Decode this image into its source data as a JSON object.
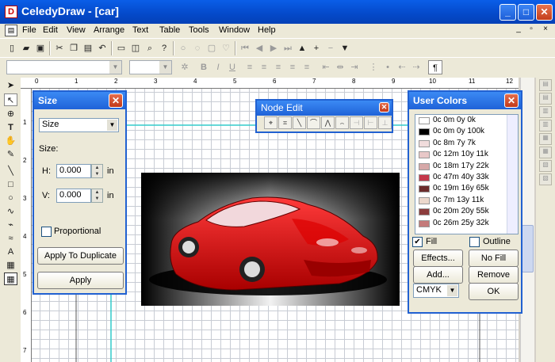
{
  "window": {
    "title": "CeledyDraw - [car]",
    "minimize": "_",
    "maximize": "□",
    "close": "✕"
  },
  "menu": {
    "items": [
      "File",
      "Edit",
      "View",
      "Arrange",
      "Text",
      "Table",
      "Tools",
      "Window",
      "Help"
    ],
    "mdi": [
      "_",
      "▫",
      "×"
    ]
  },
  "ruler": {
    "top_numbers": [
      "0",
      "1",
      "2",
      "3",
      "4",
      "5",
      "6",
      "7",
      "8",
      "9",
      "10",
      "11",
      "12"
    ],
    "left_numbers": [
      "1",
      "2",
      "3",
      "4",
      "5",
      "6",
      "7"
    ]
  },
  "size_panel": {
    "title": "Size",
    "mode_select": "Size",
    "size_label": "Size:",
    "h_label": "H:",
    "h_value": "0.000",
    "h_unit": "in",
    "v_label": "V:",
    "v_value": "0.000",
    "v_unit": "in",
    "proportional_label": "Proportional",
    "apply_dup_label": "Apply To Duplicate",
    "apply_label": "Apply"
  },
  "node_edit": {
    "title": "Node Edit"
  },
  "user_colors": {
    "title": "User Colors",
    "colors": [
      {
        "name": "0c 0m 0y 0k",
        "hex": "#ffffff"
      },
      {
        "name": "0c 0m 0y 100k",
        "hex": "#000000"
      },
      {
        "name": "0c 8m 7y 7k",
        "hex": "#f0dcdc"
      },
      {
        "name": "0c 12m 10y 11k",
        "hex": "#e8c8c8"
      },
      {
        "name": "0c 18m 17y 22k",
        "hex": "#d6a8a8"
      },
      {
        "name": "0c 47m 40y 33k",
        "hex": "#c4384b"
      },
      {
        "name": "0c 19m 16y 65k",
        "hex": "#6c2c2c"
      },
      {
        "name": "0c 7m 13y 11k",
        "hex": "#ecd8cc"
      },
      {
        "name": "0c 20m 20y 55k",
        "hex": "#8c3c3c"
      },
      {
        "name": "0c 26m 25y 32k",
        "hex": "#c47a7a"
      }
    ],
    "fill_label": "Fill",
    "outline_label": "Outline",
    "effects_label": "Effects...",
    "nofill_label": "No Fill",
    "add_label": "Add...",
    "remove_label": "Remove",
    "model_select": "CMYK",
    "ok_label": "OK"
  }
}
